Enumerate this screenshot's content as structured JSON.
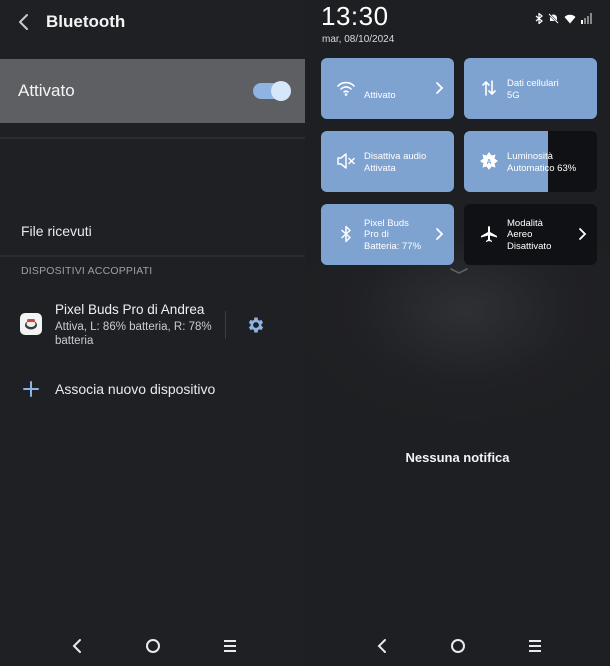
{
  "left": {
    "title": "Bluetooth",
    "toggle": {
      "label": "Attivato",
      "state": "on"
    },
    "files_label": "File ricevuti",
    "section_header": "DISPOSITIVI ACCOPPIATI",
    "device": {
      "name": "Pixel Buds Pro di Andrea",
      "status": "Attiva, L: 86% batteria, R: 78% batteria"
    },
    "add_label": "Associa nuovo dispositivo"
  },
  "right": {
    "time": "13:30",
    "date": "mar, 08/10/2024",
    "tiles": {
      "wifi": {
        "line1": "",
        "line2": "Attivato"
      },
      "mobile": {
        "line1": "Dati cellulari",
        "line2": "5G"
      },
      "audio": {
        "line1": "Disattiva audio",
        "line2": "Attivata"
      },
      "brightness": {
        "line1": "Luminosità",
        "line2": "Automatico 63%",
        "level_percent": 63
      },
      "bluetooth": {
        "line1": "Pixel Buds",
        "line2": "Pro di",
        "line3": "Batteria: 77%"
      },
      "airplane": {
        "line1": "Modalità",
        "line2": "Aereo",
        "line3": "Disattivato"
      }
    },
    "empty_text": "Nessuna notifica"
  },
  "colors": {
    "tile_active": "#7ea3d1",
    "tile_inactive": "#101114",
    "accent": "#8eb4e3"
  }
}
